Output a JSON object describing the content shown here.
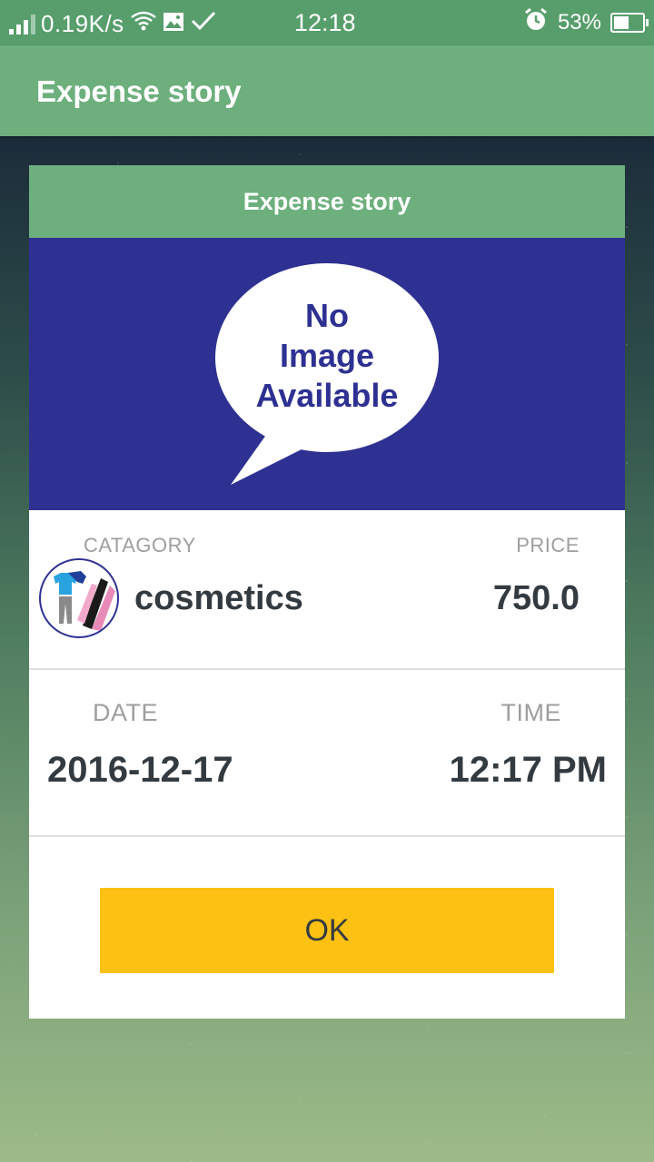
{
  "status_bar": {
    "network_speed": "0.19K/s",
    "time": "12:18",
    "battery_percent": "53%",
    "battery_level": 0.53,
    "icons": [
      "signal-icon",
      "wifi-icon",
      "image-icon",
      "check-icon",
      "alarm-icon",
      "battery-icon"
    ]
  },
  "app_bar": {
    "title": "Expense story"
  },
  "dialog": {
    "title": "Expense story",
    "image_placeholder": {
      "line1": "No",
      "line2": "Image",
      "line3": "Available"
    },
    "category_label": "CATAGORY",
    "category_value": "cosmetics",
    "price_label": "PRICE",
    "price_value": "750.0",
    "date_label": "DATE",
    "date_value": "2016-12-17",
    "time_label": "TIME",
    "time_value": "12:17 PM",
    "ok_label": "OK"
  },
  "colors": {
    "status_bar": "#579e6c",
    "app_bar": "#6daf7d",
    "image_bg": "#2e3192",
    "ok_button": "#fdc113",
    "value_text": "#333a40",
    "label_text": "#9e9e9e"
  }
}
